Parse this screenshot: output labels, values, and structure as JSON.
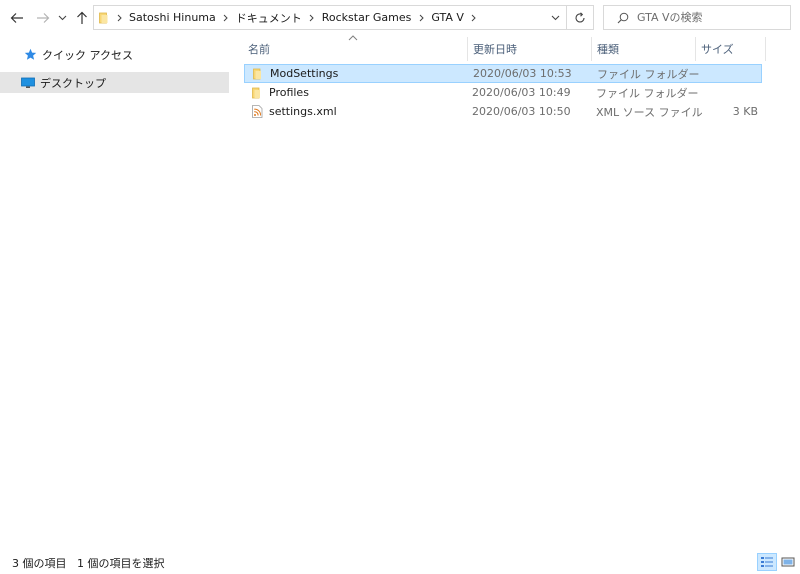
{
  "address_bar": {
    "breadcrumbs": [
      "Satoshi Hinuma",
      "ドキュメント",
      "Rockstar Games",
      "GTA V"
    ]
  },
  "search": {
    "placeholder": "GTA Vの検索"
  },
  "nav_pane": {
    "items": [
      {
        "label": "クイック アクセス",
        "icon": "star-icon"
      },
      {
        "label": "デスクトップ",
        "icon": "desktop-icon",
        "selected": true
      }
    ]
  },
  "columns": {
    "name": "名前",
    "date": "更新日時",
    "type": "種類",
    "size": "サイズ"
  },
  "files": [
    {
      "name": "ModSettings",
      "date": "2020/06/03 10:53",
      "type": "ファイル フォルダー",
      "size": "",
      "icon": "folder-icon",
      "selected": true
    },
    {
      "name": "Profiles",
      "date": "2020/06/03 10:49",
      "type": "ファイル フォルダー",
      "size": "",
      "icon": "folder-icon",
      "selected": false
    },
    {
      "name": "settings.xml",
      "date": "2020/06/03 10:50",
      "type": "XML ソース ファイル",
      "size": "3 KB",
      "icon": "xml-file-icon",
      "selected": false
    }
  ],
  "status_bar": {
    "item_count": "3 個の項目",
    "selected_count": "1 個の項目を選択"
  },
  "colors": {
    "selection_bg": "#cce8ff",
    "selection_border": "#99d1ff",
    "nav_selected_bg": "#e5e5e5",
    "folder_yellow": "#f8d775"
  }
}
